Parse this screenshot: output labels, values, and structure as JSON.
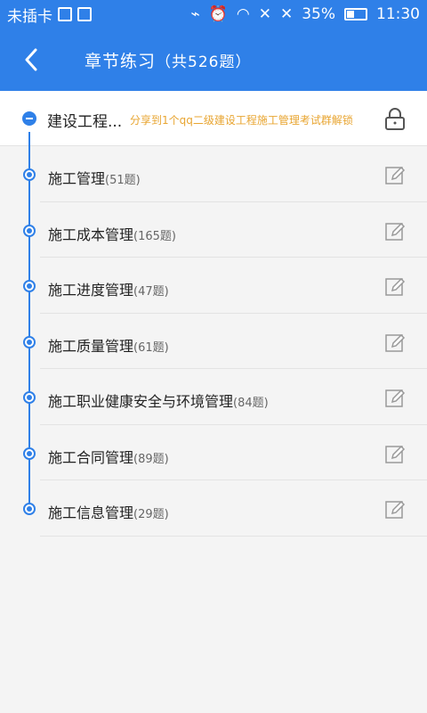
{
  "status_bar": {
    "carrier": "未插卡",
    "battery": "35%",
    "time": "11:30"
  },
  "header": {
    "title": "章节练习",
    "subtitle": "（共526题）"
  },
  "root": {
    "name": "建设工程...",
    "share_note": "分享到1个qq二级建设工程施工管理考试群解锁"
  },
  "chapters": [
    {
      "name": "施工管理",
      "count": "(51题)"
    },
    {
      "name": "施工成本管理",
      "count": "(165题)"
    },
    {
      "name": "施工进度管理",
      "count": "(47题)"
    },
    {
      "name": "施工质量管理",
      "count": "(61题)"
    },
    {
      "name": "施工职业健康安全与环境管理",
      "count": "(84题)"
    },
    {
      "name": "施工合同管理",
      "count": "(89题)"
    },
    {
      "name": "施工信息管理",
      "count": "(29题)"
    }
  ],
  "colors": {
    "accent": "#2f80e8",
    "warning": "#e8a531"
  }
}
